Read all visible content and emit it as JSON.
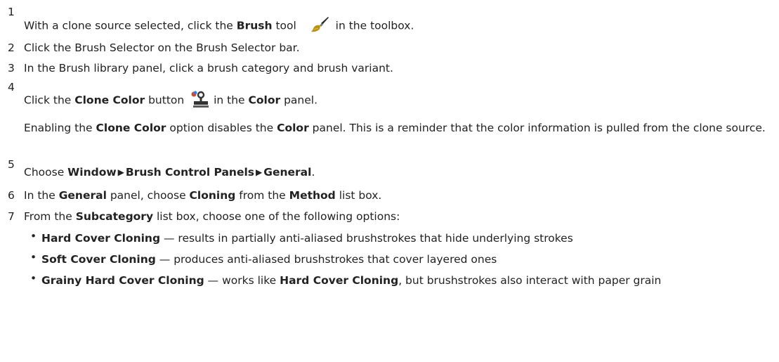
{
  "steps": {
    "s1": {
      "num": "1",
      "a": "With a clone source selected, click the ",
      "b": "Brush",
      "c": " tool",
      "d": " in the toolbox.",
      "icon": "brush-tool-icon"
    },
    "s2": {
      "num": "2",
      "text": "Click the Brush Selector on the Brush Selector bar."
    },
    "s3": {
      "num": "3",
      "text": "In the Brush library panel, click a brush category and brush variant."
    },
    "s4": {
      "num": "4",
      "a": "Click the ",
      "b": "Clone Color",
      "c": " button ",
      "d": " in the ",
      "e": "Color",
      "f": " panel.",
      "icon": "clone-color-stamp-icon",
      "note": {
        "a": "Enabling the ",
        "b": "Clone Color",
        "c": " option disables the ",
        "d": "Color",
        "e": " panel. This is a reminder that the color information is pulled from the clone source."
      }
    },
    "s5": {
      "num": "5",
      "a": "Choose ",
      "b": "Window",
      "c": "Brush Control Panels",
      "d": "General",
      "e": ".",
      "arrow": "▶"
    },
    "s6": {
      "num": "6",
      "a": "In the ",
      "b": "General",
      "c": " panel, choose ",
      "d": "Cloning",
      "e": " from the ",
      "f": "Method",
      "g": " list box."
    },
    "s7": {
      "num": "7",
      "a": "From the ",
      "b": "Subcategory",
      "c": " list box, choose one of the following options:",
      "bullet": "•",
      "o1": {
        "a": "Hard Cover Cloning",
        "b": " — results in partially anti-aliased brushstrokes that hide underlying strokes"
      },
      "o2": {
        "a": "Soft Cover Cloning",
        "b": " — produces anti-aliased brushstrokes that cover layered ones"
      },
      "o3": {
        "a": "Grainy Hard Cover Cloning",
        "b": " — works like ",
        "c": "Hard Cover Cloning",
        "d": ", but brushstrokes also interact with paper grain"
      }
    }
  }
}
